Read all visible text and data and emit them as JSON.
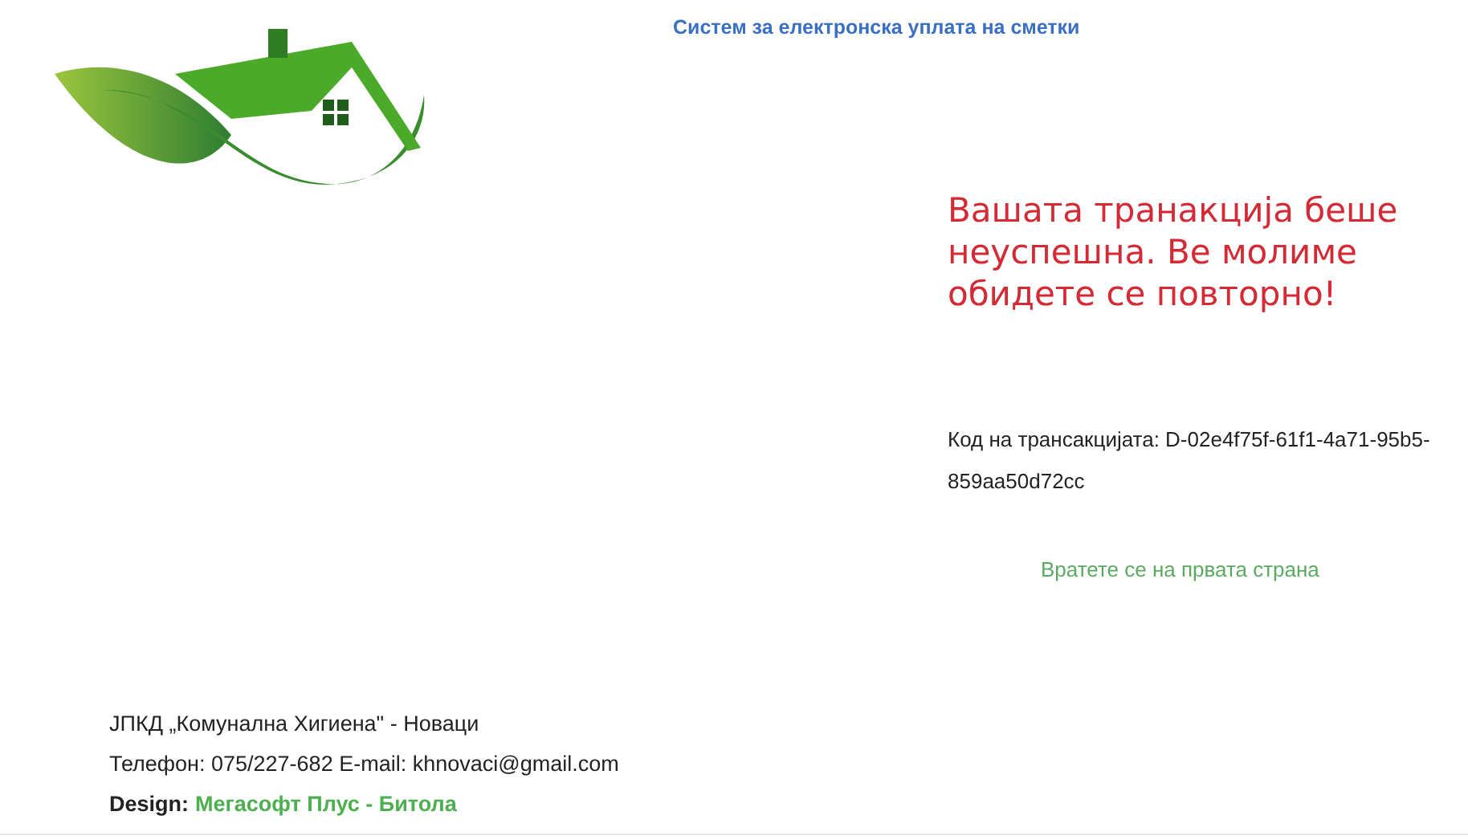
{
  "header": {
    "title": "Систем за електронска уплата на сметки"
  },
  "result": {
    "message": "Вашата транакција беше неуспешна. Ве молиме обидете се повторно!",
    "transaction_code": "Код на трансакцијата: D-02e4f75f-61f1-4a71-95b5-859aa50d72cc",
    "home_link": "Вратете се на првата страна"
  },
  "footer": {
    "company": "ЈПКД „Комунална Хигиена\" - Новаци",
    "contact": "Телефон: 075/227-682 E-mail: khnovaci@gmail.com",
    "design_label": "Design:",
    "design_by": "Мегасофт Плус - Битола"
  }
}
